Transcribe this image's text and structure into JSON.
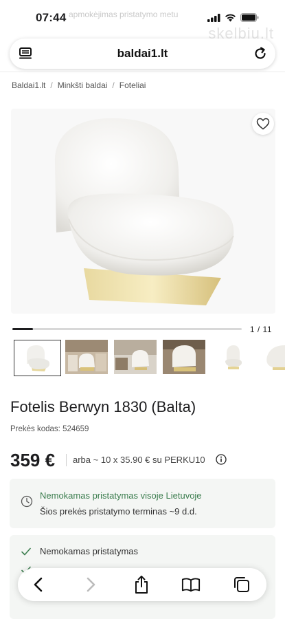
{
  "status": {
    "time": "07:44"
  },
  "background_ghost": {
    "text1": "apmokėjimas pristatymo metu",
    "text2": "skelbiu.lt"
  },
  "browser": {
    "url": "baldai1.lt",
    "menu_icon": "tab-overview-icon",
    "reload_icon": "reload-icon"
  },
  "breadcrumb": {
    "items": [
      "Baldai1.lt",
      "Minkšti baldai",
      "Foteliai"
    ],
    "separator": "/"
  },
  "gallery": {
    "counter": "1 / 11",
    "progress_fraction": 0.09,
    "favorite_icon": "heart-icon",
    "thumbnail_count": 6
  },
  "product": {
    "title": "Fotelis Berwyn 1830 (Balta)",
    "sku": "Prekės kodas: 524659",
    "price": "359 €",
    "installment": "arba ~ 10 x 35.90 € su PERKU10",
    "info_icon": "info-icon"
  },
  "delivery": {
    "title": "Nemokamas pristatymas visoje Lietuvoje",
    "subtitle": "Šios prekės pristatymo terminas ~9 d.d.",
    "icon": "clock-icon"
  },
  "benefits": [
    {
      "label": "Nemokamas pristatymas"
    }
  ],
  "toolbar": {
    "back_icon": "back-arrow-icon",
    "forward_icon": "forward-arrow-icon",
    "share_icon": "share-icon",
    "bookmarks_icon": "bookmarks-icon",
    "tabs_icon": "tabs-icon"
  },
  "colors": {
    "accent_green": "#3b7d4e",
    "text": "#1d1d1f"
  }
}
